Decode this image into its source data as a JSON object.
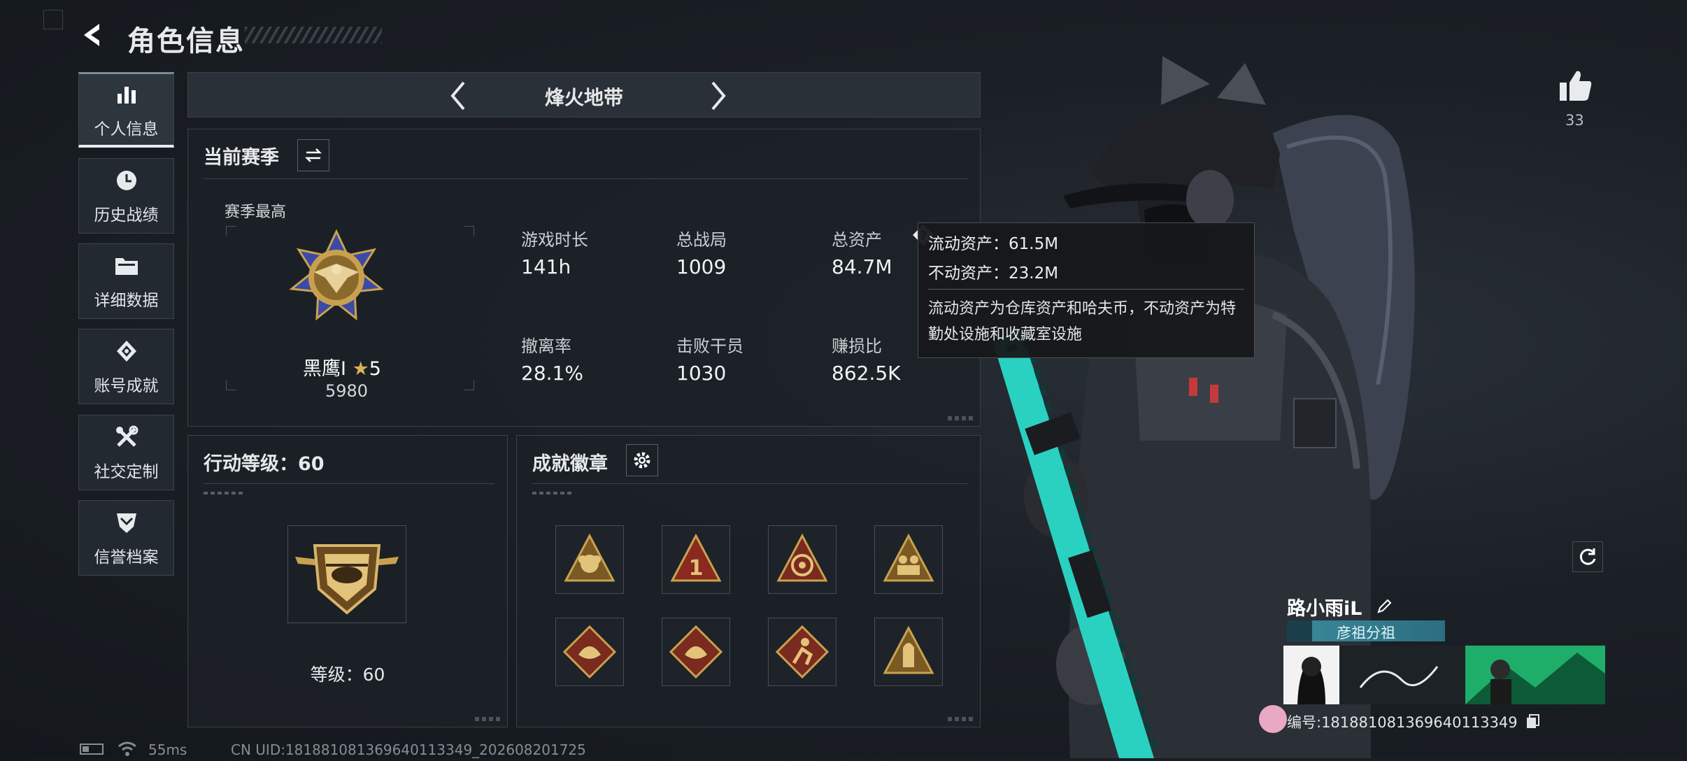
{
  "header": {
    "title": "角色信息"
  },
  "sidebar": {
    "items": [
      {
        "label": "个人信息",
        "icon": "bar-chart-icon",
        "active": true
      },
      {
        "label": "历史战绩",
        "icon": "history-clock-icon",
        "active": false
      },
      {
        "label": "详细数据",
        "icon": "folder-icon",
        "active": false
      },
      {
        "label": "账号成就",
        "icon": "achievement-icon",
        "active": false
      },
      {
        "label": "社交定制",
        "icon": "tools-icon",
        "active": false
      },
      {
        "label": "信誉档案",
        "icon": "shield-chevron-icon",
        "active": false
      }
    ]
  },
  "mode": {
    "name": "烽火地带"
  },
  "season": {
    "title": "当前赛季",
    "peak_label": "赛季最高",
    "rank_name": "黑鹰I",
    "rank_stars": "5",
    "rank_score": "5980",
    "stats": [
      {
        "label": "游戏时长",
        "value": "141h"
      },
      {
        "label": "总战局",
        "value": "1009"
      },
      {
        "label": "总资产",
        "value": "84.7M"
      },
      {
        "label": "撤离率",
        "value": "28.1%"
      },
      {
        "label": "击败干员",
        "value": "1030"
      },
      {
        "label": "赚损比",
        "value": "862.5K"
      }
    ]
  },
  "tooltip": {
    "liquid": "流动资产：61.5M",
    "fixed": "不动资产：23.2M",
    "desc": "流动资产为仓库资产和哈夫币，不动资产为特勤处设施和收藏室设施"
  },
  "action_level": {
    "title": "行动等级：60",
    "level_text": "等级：60"
  },
  "badges": {
    "title": "成就徽章"
  },
  "like": {
    "count": "33"
  },
  "profile": {
    "name": "路小雨iL",
    "clan": "彦祖分祖",
    "uid_label": "编号:1818810813696401133​49"
  },
  "footer": {
    "ping": "55ms",
    "uid": "CN UID:181881081369640113349_202608201725"
  },
  "colors": {
    "background": "#1b2026",
    "panel": "#1c2127",
    "clan_bar": "#2c6d81",
    "accent_teal": "#2ad1c0",
    "medal_gold": "#c9a14e"
  }
}
